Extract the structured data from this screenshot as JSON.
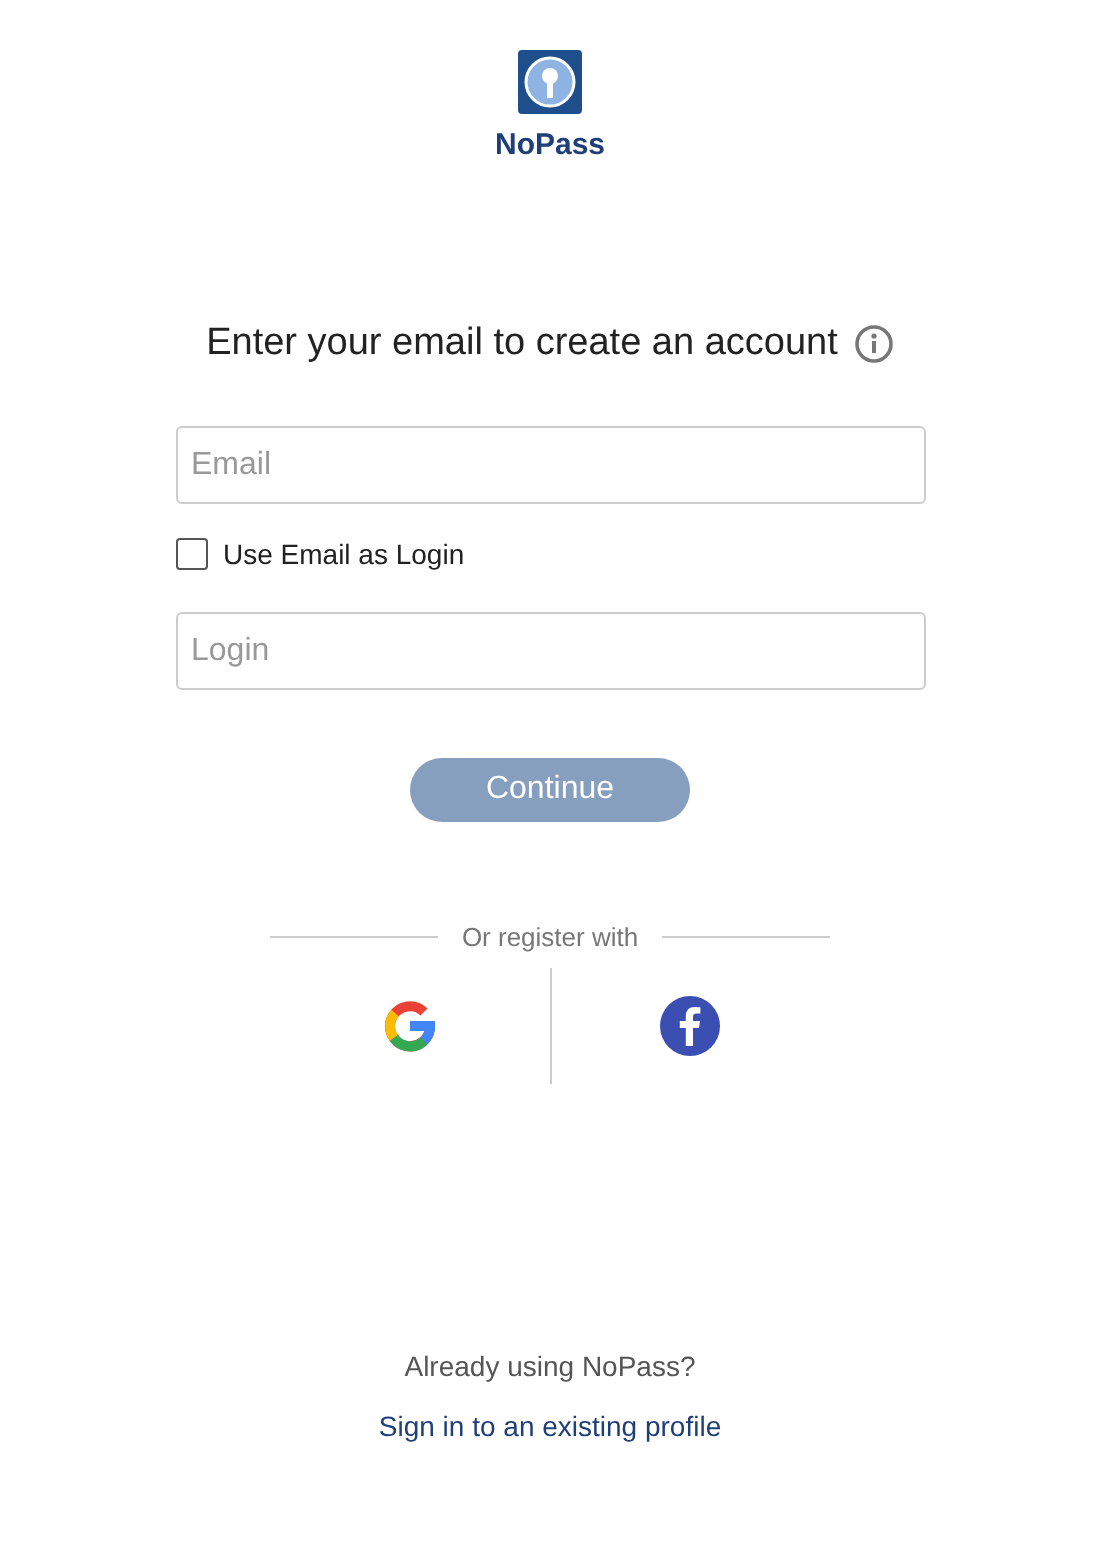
{
  "brand": {
    "name": "NoPass"
  },
  "heading": "Enter your email to create an account",
  "email_field": {
    "placeholder": "Email"
  },
  "use_email_checkbox": {
    "label": "Use Email as Login",
    "checked": false
  },
  "login_field": {
    "placeholder": "Login"
  },
  "continue_button": {
    "label": "Continue",
    "disabled": true
  },
  "divider_text": "Or register with",
  "social": [
    {
      "kind": "google"
    },
    {
      "kind": "facebook"
    }
  ],
  "footer": {
    "question": "Already using NoPass?",
    "link": "Sign in to an existing profile"
  }
}
